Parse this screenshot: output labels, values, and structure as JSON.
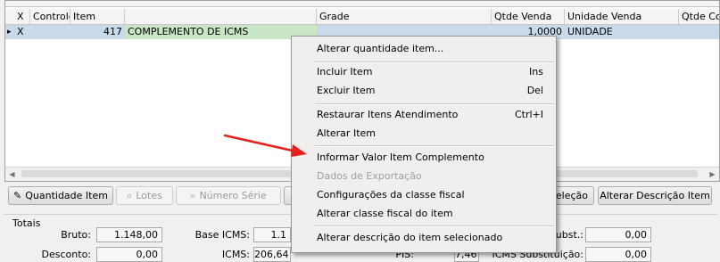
{
  "grid": {
    "columns": [
      "X",
      "Controle",
      "Item",
      "",
      "Grade",
      "Qtde Venda",
      "Unidade Venda",
      "Qtde Co"
    ],
    "row": {
      "marker": "▸",
      "x": "X",
      "controle": "",
      "item": "417",
      "description": "COMPLEMENTO DE ICMS",
      "grade": "",
      "qtde_venda": "1,0000",
      "unidade_venda": "UNIDADE",
      "qtde_co": ""
    },
    "scroll_left": "◀",
    "scroll_right": "▶"
  },
  "buttons": {
    "quantidade_item": "Quantidade Item",
    "lotes": "Lotes",
    "numero_serie": "Número Série",
    "selecao": "eleção",
    "alterar_descricao": "Alterar Descrição Item"
  },
  "totals": {
    "title": "Totais",
    "bruto_label": "Bruto:",
    "bruto_value": "1.148,00",
    "desconto_label": "Desconto:",
    "desconto_value": "0,00",
    "base_icms_label": "Base ICMS:",
    "base_icms_value": "1.1",
    "icms_label": "ICMS:",
    "icms_value": "206,64",
    "pis_label": "PIS:",
    "pis_value": "7,46",
    "subst_label": "ubst.:",
    "subst_value": "0,00",
    "icms_subst_label": "ICMS Substituição:",
    "icms_subst_value": "0,00"
  },
  "context_menu": {
    "items": [
      {
        "label": "Alterar quantidade item...",
        "shortcut": ""
      },
      {
        "label": "Incluir Item",
        "shortcut": "Ins"
      },
      {
        "label": "Excluir Item",
        "shortcut": "Del"
      },
      {
        "label": "Restaurar Itens Atendimento",
        "shortcut": "Ctrl+I"
      },
      {
        "label": "Alterar Item",
        "shortcut": ""
      },
      {
        "label": "Informar Valor Item Complemento",
        "shortcut": ""
      },
      {
        "label": "Dados de Exportação",
        "shortcut": ""
      },
      {
        "label": "Configurações da classe fiscal",
        "shortcut": ""
      },
      {
        "label": "Alterar classe fiscal do item",
        "shortcut": ""
      },
      {
        "label": "Alterar descrição do item selecionado",
        "shortcut": ""
      }
    ]
  },
  "colors": {
    "selected_row": "#c9daea",
    "description_cell": "#c9e6c6",
    "arrow": "#e8201c"
  }
}
